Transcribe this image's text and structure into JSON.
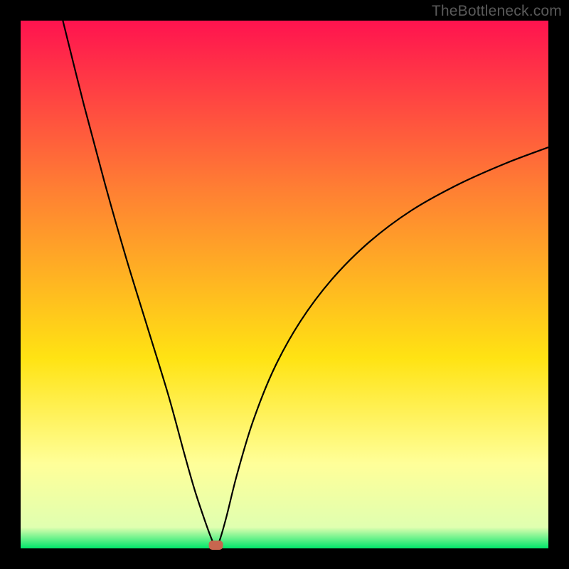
{
  "watermark": "TheBottleneck.com",
  "chart_data": {
    "type": "line",
    "title": "",
    "xlabel": "",
    "ylabel": "",
    "xlim": [
      0,
      100
    ],
    "ylim": [
      0,
      100
    ],
    "background_gradient_top": "#ff134f",
    "background_gradient_mid_upper": "#ff7f33",
    "background_gradient_mid_lower": "#ffe313",
    "background_gradient_band": "#ffff99",
    "background_gradient_bottom": "#00e66a",
    "frame_color": "#000000",
    "curve_color": "#000000",
    "marker": {
      "x": 37,
      "y": 0,
      "color": "#c8664f",
      "shape": "rounded-rect"
    },
    "series": [
      {
        "name": "left-branch",
        "x": [
          8,
          12,
          16,
          20,
          24,
          28,
          31,
          33,
          35,
          36.3,
          37
        ],
        "y": [
          100,
          84,
          69,
          55,
          42,
          29,
          18,
          11,
          5,
          1.5,
          0.3
        ]
      },
      {
        "name": "right-branch",
        "x": [
          37,
          37.7,
          39,
          41,
          44,
          48,
          53,
          59,
          66,
          74,
          83,
          92,
          100
        ],
        "y": [
          0.3,
          1.5,
          6,
          14,
          24,
          34,
          43,
          51,
          58,
          64,
          69,
          73,
          76
        ]
      }
    ]
  }
}
